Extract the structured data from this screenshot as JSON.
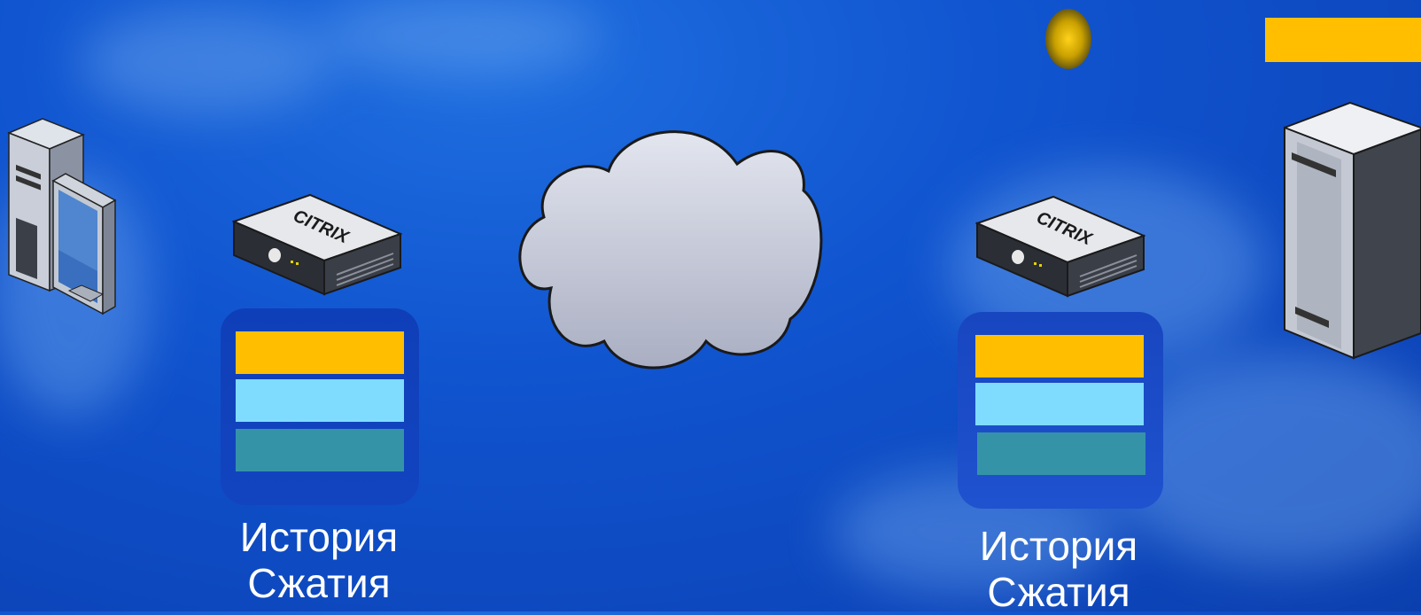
{
  "diagram": {
    "left_site": {
      "appliance_label": "CITRIX",
      "caption_line1": "История",
      "caption_line2": "Сжатия"
    },
    "right_site": {
      "appliance_label": "CITRIX",
      "caption_line1": "История",
      "caption_line2": "Сжатия"
    }
  },
  "colors": {
    "history_bar_top": "#ffbf00",
    "history_bar_middle": "#7fdcff",
    "history_bar_bottom": "#3593a8",
    "packet_bar": "#ffbf00",
    "packet_dot": "#c9a000"
  }
}
